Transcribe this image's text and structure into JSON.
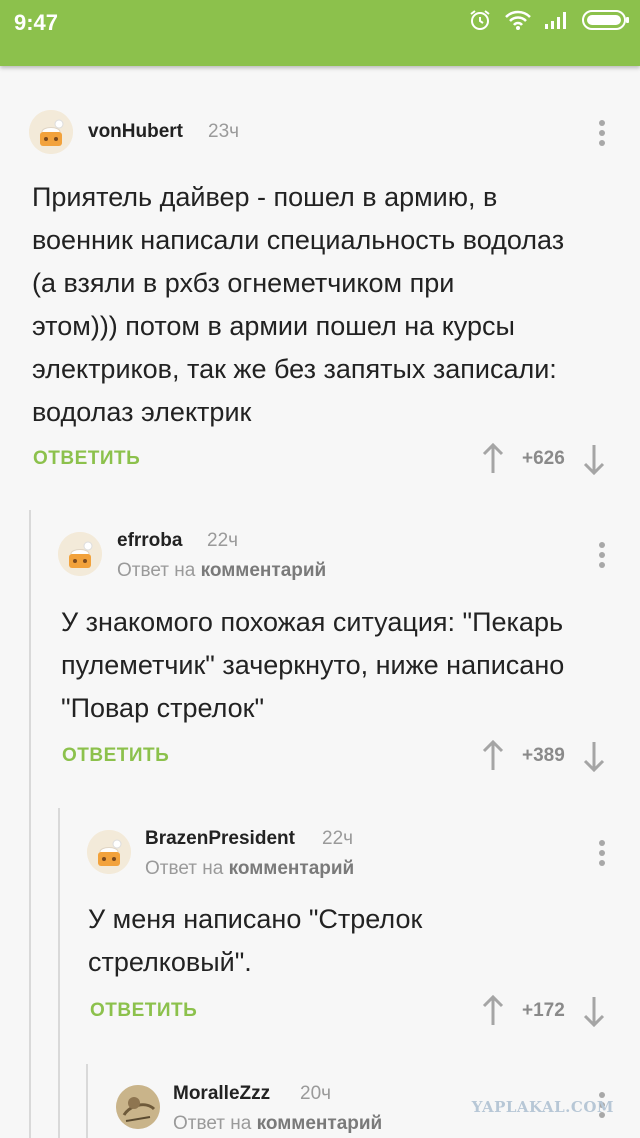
{
  "status_bar": {
    "time": "9:47",
    "icons": [
      "alarm-icon",
      "wifi-icon",
      "signal-icon",
      "battery-icon"
    ]
  },
  "colors": {
    "accent": "#8cc14c",
    "muted": "#9a9a9a",
    "thread_line": "#d9d9d9"
  },
  "comments": [
    {
      "username": "vonHubert",
      "time": "23ч",
      "reply_to": null,
      "lines": [
        "Приятель дайвер - пошел в армию, в",
        "военник написали специальность водолаз",
        "(а взяли в рхбз огнеметчиком при",
        "этом))) потом в армии пошел на курсы",
        "электриков, так же без запятых записали:",
        "водолаз электрик"
      ],
      "reply_label": "ОТВЕТИТЬ",
      "score": "+626"
    },
    {
      "username": "efrroba",
      "time": "22ч",
      "reply_to": {
        "prefix": "Ответ на",
        "target": "комментарий"
      },
      "lines": [
        "У знакомого похожая ситуация: \"Пекарь",
        "пулеметчик\" зачеркнуто, ниже написано",
        "\"Повар стрелок\""
      ],
      "reply_label": "ОТВЕТИТЬ",
      "score": "+389"
    },
    {
      "username": "BrazenPresident",
      "time": "22ч",
      "reply_to": {
        "prefix": "Ответ на",
        "target": "комментарий"
      },
      "lines": [
        "У меня написано \"Стрелок",
        "стрелковый\"."
      ],
      "reply_label": "ОТВЕТИТЬ",
      "score": "+172"
    },
    {
      "username": "MoralleZzz",
      "time": "20ч",
      "reply_to": {
        "prefix": "Ответ на",
        "target": "комментарий"
      },
      "lines": [],
      "reply_label": "",
      "score": ""
    }
  ],
  "watermark": "YAPLAKAL.COM"
}
